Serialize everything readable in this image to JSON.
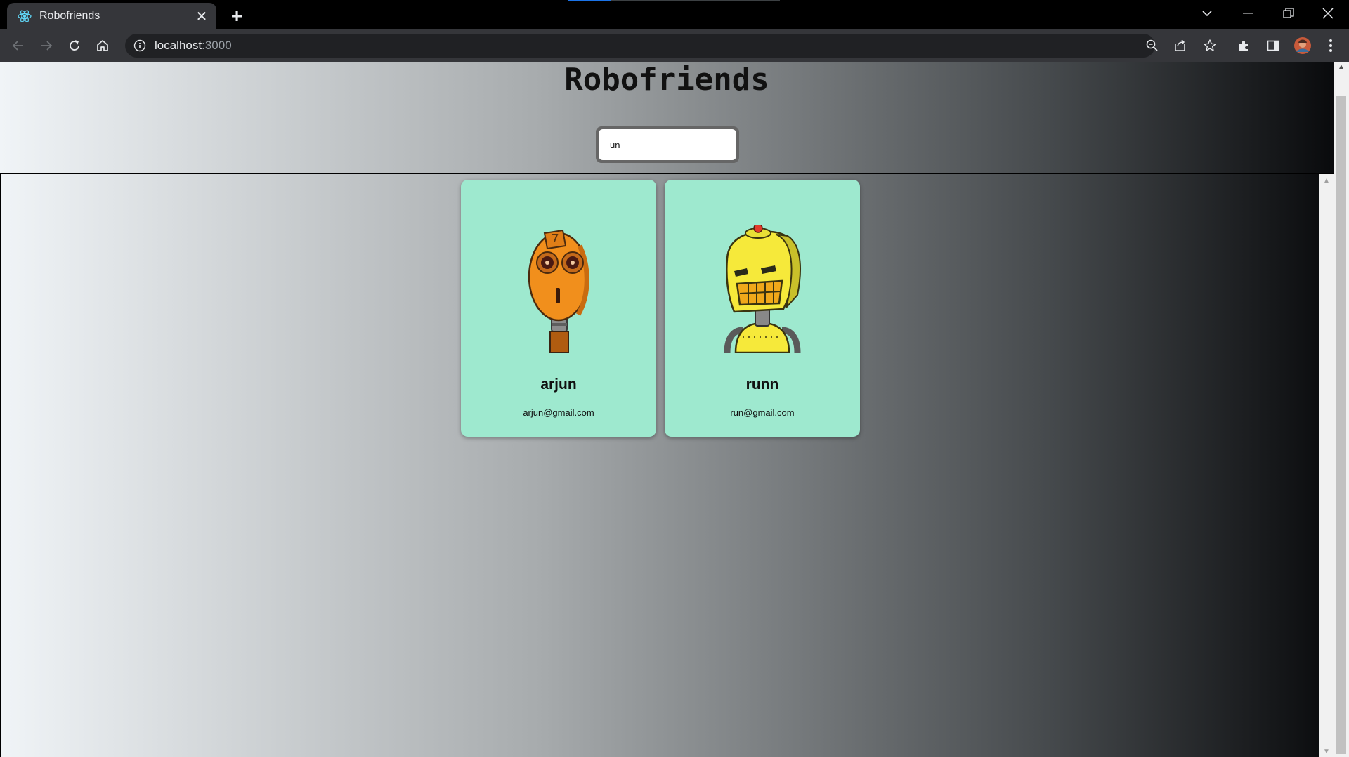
{
  "browser": {
    "tab_title": "Robofriends",
    "url_host": "localhost",
    "url_port": ":3000"
  },
  "app": {
    "title": "Robofriends",
    "search": {
      "value": "un"
    }
  },
  "robots": [
    {
      "name": "arjun",
      "email": "arjun@gmail.com"
    },
    {
      "name": "runn",
      "email": "run@gmail.com"
    }
  ],
  "colors": {
    "card_bg": "#9ee9cf",
    "robot1_primary": "#f18f1c",
    "robot2_primary": "#f6e93a"
  }
}
